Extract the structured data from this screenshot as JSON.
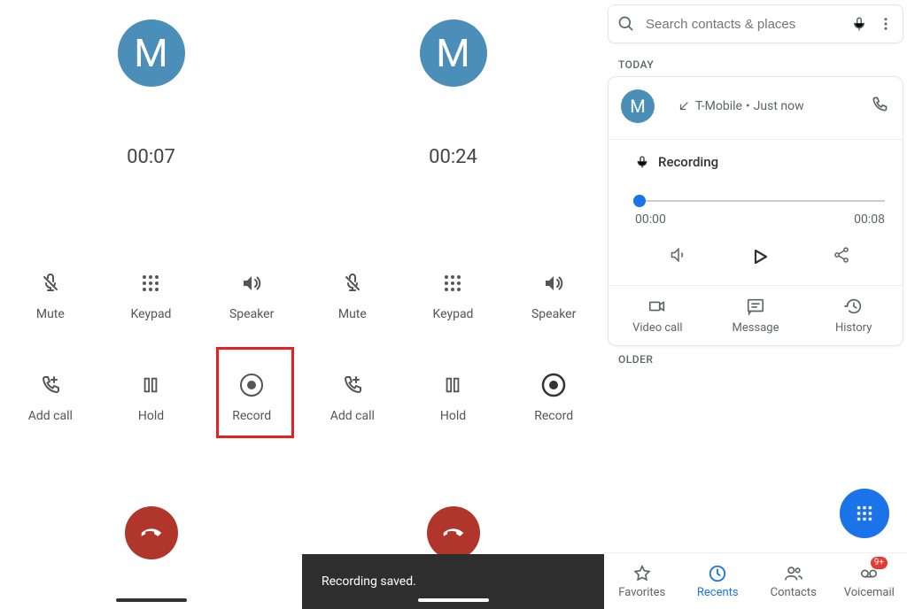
{
  "avatar_initial": "M",
  "pane1": {
    "timer": "00:07",
    "mute": "Mute",
    "keypad": "Keypad",
    "speaker": "Speaker",
    "add_call": "Add call",
    "hold": "Hold",
    "record": "Record"
  },
  "pane2": {
    "timer": "00:24",
    "mute": "Mute",
    "keypad": "Keypad",
    "speaker": "Speaker",
    "add_call": "Add call",
    "hold": "Hold",
    "record": "Record",
    "toast": "Recording saved."
  },
  "pane3": {
    "search_placeholder": "Search contacts & places",
    "today_label": "TODAY",
    "older_label": "OLDER",
    "carrier": "T-Mobile",
    "when": "Just now",
    "sep_dot": "•",
    "recording_label": "Recording",
    "time_start": "00:00",
    "time_end": "00:08",
    "video_call": "Video call",
    "message": "Message",
    "history": "History",
    "nav_favorites": "Favorites",
    "nav_recents": "Recents",
    "nav_contacts": "Contacts",
    "nav_voicemail": "Voicemail",
    "voicemail_badge": "9+"
  }
}
